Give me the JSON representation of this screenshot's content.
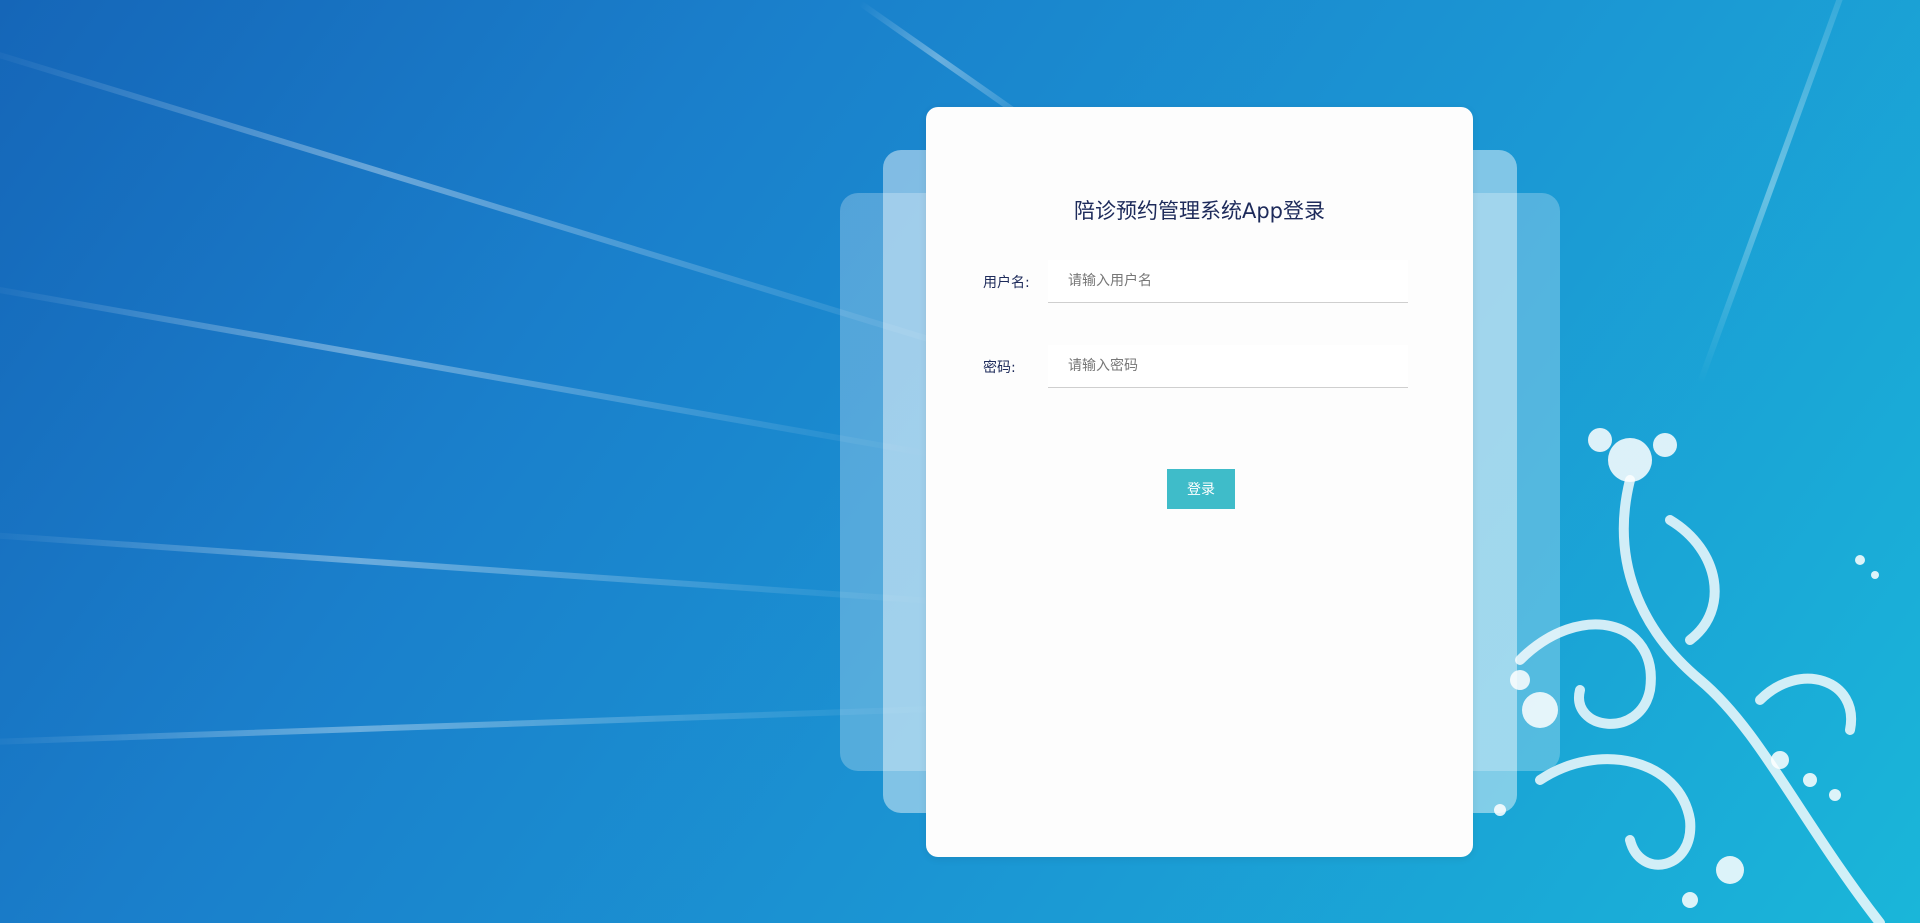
{
  "login": {
    "title": "陪诊预约管理系统App登录",
    "username_label": "用户名:",
    "username_placeholder": "请输入用户名",
    "password_label": "密码:",
    "password_placeholder": "请输入密码",
    "submit_label": "登录"
  },
  "colors": {
    "accent": "#3fbcc9",
    "title_text": "#1d2a5a",
    "background_start": "#1566b8",
    "background_end": "#1ab6d9"
  }
}
